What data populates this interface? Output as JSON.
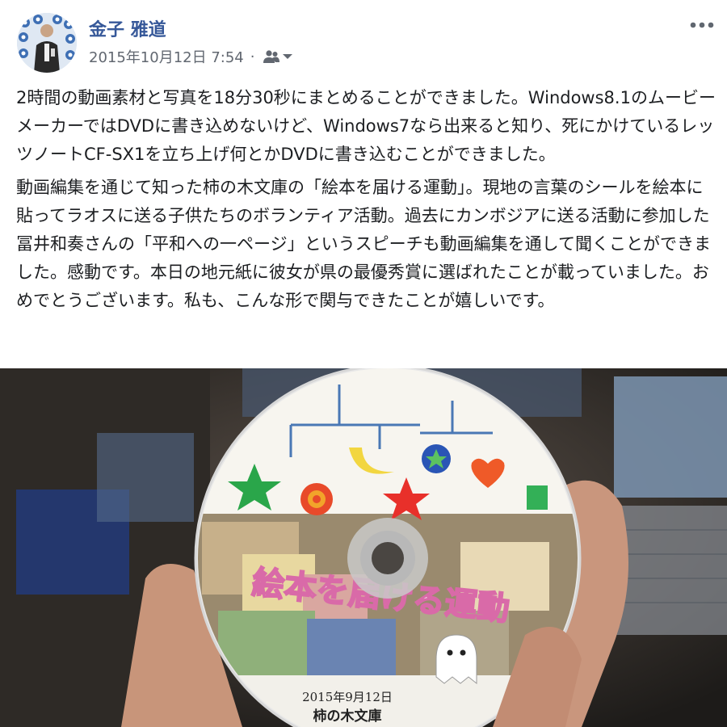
{
  "post": {
    "author_name": "金子 雅道",
    "timestamp": "2015年10月12日 7:54",
    "separator": "·",
    "audience_icon": "friends-icon",
    "more_icon": "more-horizontal-icon",
    "paragraphs": [
      "2時間の動画素材と写真を18分30秒にまとめることができました。Windows8.1のムービーメーカーではDVDに書き込めないけど、Windows7なら出来ると知り、死にかけているレッツノートCF-SX1を立ち上げ何とかDVDに書き込むことができました。",
      "動画編集を通じて知った柿の木文庫の「絵本を届ける運動」。現地の言葉のシールを絵本に貼ってラオスに送る子供たちのボランティア活動。過去にカンボジアに送る活動に参加した冨井和奏さんの「平和への一ページ」というスピーチも動画編集を通して聞くことができました。感動です。本日の地元紙に彼女が県の最優秀賞に選ばれたことが載っていました。おめでとうございます。私も、こんな形で関与できたことが嬉しいです。"
    ]
  },
  "photo": {
    "disc_title": "絵本を届ける運動",
    "disc_date": "2015年9月12日",
    "disc_publisher": "柿の木文庫"
  },
  "colors": {
    "name_link": "#365899",
    "meta_text": "#616770",
    "body_text": "#1c1e21"
  }
}
